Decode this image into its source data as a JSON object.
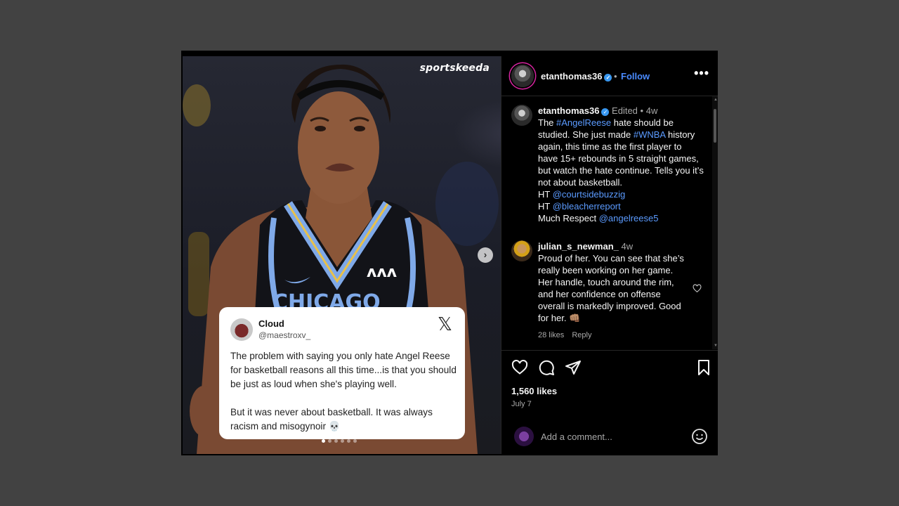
{
  "media": {
    "watermark": "sportskeeda",
    "carousel_dots": 6,
    "active_dot": 0,
    "next_icon": "chevron-right-icon",
    "next_glyph": "›",
    "tweet": {
      "name": "Cloud",
      "handle": "@maestroxv_",
      "logo": "𝕏",
      "body": "The problem with saying you only hate Angel Reese for basketball reasons all this time...is that you should be just as loud when she's playing well.\n\nBut it was never about basketball. It was always racism and misogynoir 💀"
    }
  },
  "header": {
    "username": "etanthomas36",
    "separator": "•",
    "follow_label": "Follow",
    "more_label": "•••"
  },
  "caption": {
    "username": "etanthomas36",
    "edited": "Edited",
    "sep": "•",
    "age": "4w",
    "t1": "The ",
    "tag1": "#AngelReese",
    "t2": " hate should be studied. She just made ",
    "tag2": "#WNBA",
    "t3": " history again, this time as the first player to have 15+ rebounds in 5 straight games, but watch the hate continue. Tells you it’s not about basketball.",
    "ht1_prefix": "HT ",
    "ht1": "@courtsidebuzzig",
    "ht2_prefix": "HT ",
    "ht2": "@bleacherreport",
    "respect_prefix": "Much Respect ",
    "respect": "@angelreese5"
  },
  "comment": {
    "username": "julian_s_newman_",
    "age": "4w",
    "text": "Proud of her. You can see that she’s really been working on her game. Her handle, touch around the rim, and her confidence on offense overall is markedly improved. Good for her. 👊🏽",
    "likes": "28 likes",
    "reply": "Reply"
  },
  "footer": {
    "likes": "1,560 likes",
    "date": "July 7",
    "comment_placeholder": "Add a comment..."
  },
  "colors": {
    "link": "#5b9bff",
    "follow": "#4a8bff",
    "verified": "#3897f0",
    "background": "#424242"
  }
}
